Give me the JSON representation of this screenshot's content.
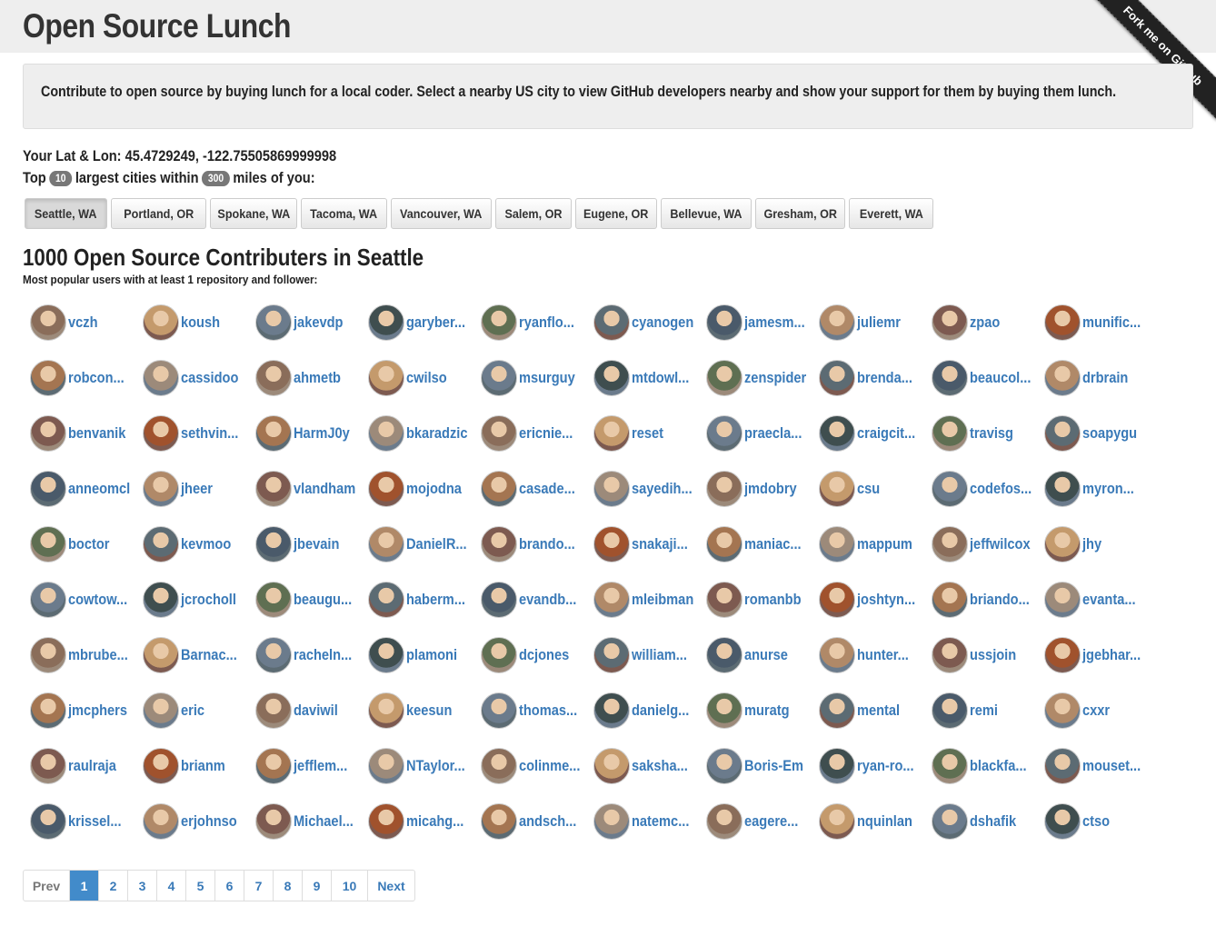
{
  "site": {
    "title": "Open Source Lunch",
    "ribbon": "Fork me on GitHub"
  },
  "intro": "Contribute to open source by buying lunch for a local coder. Select a nearby US city to view GitHub developers nearby and show your support for them by buying them lunch.",
  "location": {
    "label": "Your Lat & Lon:",
    "value": "45.4729249, -122.75505869999998"
  },
  "filter": {
    "prefix": "Top",
    "count": "10",
    "middle": "largest cities within",
    "miles": "300",
    "suffix": "miles of you:"
  },
  "cities": [
    "Seattle, WA",
    "Portland, OR",
    "Spokane, WA",
    "Tacoma, WA",
    "Vancouver, WA",
    "Salem, OR",
    "Eugene, OR",
    "Bellevue, WA",
    "Gresham, OR",
    "Everett, WA"
  ],
  "selected_city": "Seattle, WA",
  "heading": "1000 Open Source Contributers in Seattle",
  "subheading": "Most popular users with at least 1 repository and follower:",
  "users": [
    "vczh",
    "koush",
    "jakevdp",
    "garyber...",
    "ryanflo...",
    "cyanogen",
    "jamesm...",
    "juliemr",
    "zpao",
    "munific...",
    "robcon...",
    "cassidoo",
    "ahmetb",
    "cwilso",
    "msurguy",
    "mtdowl...",
    "zenspider",
    "brenda...",
    "beaucol...",
    "drbrain",
    "benvanik",
    "sethvin...",
    "HarmJ0y",
    "bkaradzic",
    "ericnie...",
    "reset",
    "praecla...",
    "craigcit...",
    "travisg",
    "soapygu",
    "anneomcl",
    "jheer",
    "vlandham",
    "mojodna",
    "casade...",
    "sayedih...",
    "jmdobry",
    "csu",
    "codefos...",
    "myron...",
    "boctor",
    "kevmoo",
    "jbevain",
    "DanielR...",
    "brando...",
    "snakaji...",
    "maniac...",
    "mappum",
    "jeffwilcox",
    "jhy",
    "cowtow...",
    "jcrocholl",
    "beaugu...",
    "haberm...",
    "evandb...",
    "mleibman",
    "romanbb",
    "joshtyn...",
    "briando...",
    "evanta...",
    "mbrube...",
    "Barnac...",
    "racheln...",
    "plamoni",
    "dcjones",
    "william...",
    "anurse",
    "hunter...",
    "ussjoin",
    "jgebhar...",
    "jmcphers",
    "eric",
    "daviwil",
    "keesun",
    "thomas...",
    "danielg...",
    "muratg",
    "mental",
    "remi",
    "cxxr",
    "raulraja",
    "brianm",
    "jefflem...",
    "NTaylor...",
    "colinme...",
    "saksha...",
    "Boris-Em",
    "ryan-ro...",
    "blackfa...",
    "mouset...",
    "krissel...",
    "erjohnso",
    "Michael...",
    "micahg...",
    "andsch...",
    "natemc...",
    "eagere...",
    "nquinlan",
    "dshafik",
    "ctso"
  ],
  "pagination": {
    "prev": "Prev",
    "pages": [
      "1",
      "2",
      "3",
      "4",
      "5",
      "6",
      "7",
      "8",
      "9",
      "10"
    ],
    "current": "1",
    "next": "Next"
  },
  "colors": {
    "link": "#3a7ab8",
    "active_page": "#428bca",
    "banner_bg": "#eeeeee"
  }
}
